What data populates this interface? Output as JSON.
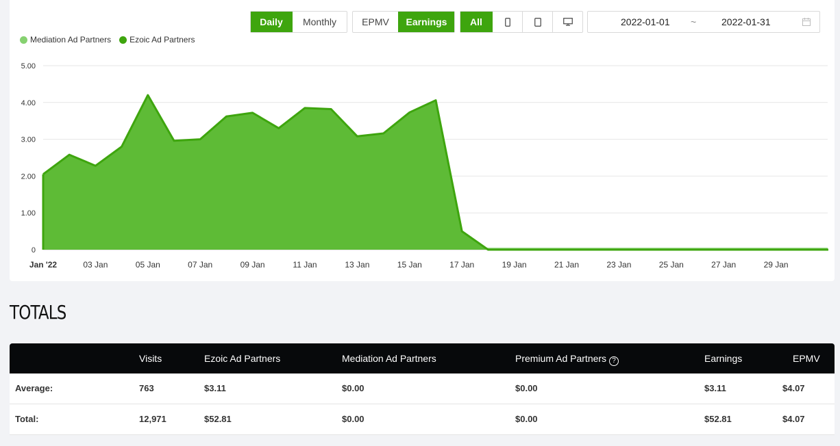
{
  "toolbar": {
    "period": [
      {
        "label": "Daily",
        "active": true
      },
      {
        "label": "Monthly",
        "active": false
      }
    ],
    "metric": [
      {
        "label": "EPMV",
        "active": false
      },
      {
        "label": "Earnings",
        "active": true
      }
    ],
    "device": [
      {
        "label": "All",
        "active": true
      }
    ],
    "device_icons": [
      "phone-icon",
      "tablet-icon",
      "desktop-icon"
    ]
  },
  "date_range": {
    "start": "2022-01-01",
    "separator": "~",
    "end": "2022-01-31",
    "icon": "calendar-icon"
  },
  "colors": {
    "mediation": "#86d170",
    "ezoic": "#3ea50e",
    "ezoic_fill": "#5ebb36",
    "header_bg": "#07090b"
  },
  "chart_data": {
    "type": "area",
    "series": [
      {
        "name": "Mediation Ad Partners",
        "values": [
          0.05,
          0.05,
          0.05,
          0.05,
          0.05,
          0.05,
          0.05,
          0.05,
          0.05,
          0.05,
          0.05,
          0.05,
          0.05,
          0.05,
          0.05,
          0.05,
          0.05,
          0.05,
          0.05,
          0.05,
          0.05,
          0.05,
          0.05,
          0.05,
          0.05,
          0.05,
          0.05,
          0.05,
          0.05,
          0.05,
          0.05
        ]
      },
      {
        "name": "Ezoic Ad Partners",
        "values": [
          2.05,
          2.58,
          2.28,
          2.8,
          4.2,
          2.96,
          3.0,
          3.62,
          3.72,
          3.3,
          3.85,
          3.82,
          3.08,
          3.16,
          3.73,
          4.06,
          0.5,
          0,
          0,
          0,
          0,
          0,
          0,
          0,
          0,
          0,
          0,
          0,
          0,
          0,
          0
        ]
      }
    ],
    "yticks": [
      "5.00",
      "4.00",
      "3.00",
      "2.00",
      "1.00",
      "0"
    ],
    "ylim": [
      0,
      5
    ],
    "xticks": [
      "Jan '22",
      "03 Jan",
      "05 Jan",
      "07 Jan",
      "09 Jan",
      "11 Jan",
      "13 Jan",
      "15 Jan",
      "17 Jan",
      "19 Jan",
      "21 Jan",
      "23 Jan",
      "25 Jan",
      "27 Jan",
      "29 Jan"
    ],
    "grid": true,
    "legend": "top-left"
  },
  "totals": {
    "title": "TOTALS",
    "headers": [
      "",
      "Visits",
      "Ezoic Ad Partners",
      "Mediation Ad Partners",
      "Premium Ad Partners",
      "Earnings",
      "EPMV"
    ],
    "help_icon": "?",
    "rows": [
      [
        "Average:",
        "763",
        "$3.11",
        "$0.00",
        "$0.00",
        "$3.11",
        "$4.07"
      ],
      [
        "Total:",
        "12,971",
        "$52.81",
        "$0.00",
        "$0.00",
        "$52.81",
        "$4.07"
      ]
    ]
  }
}
